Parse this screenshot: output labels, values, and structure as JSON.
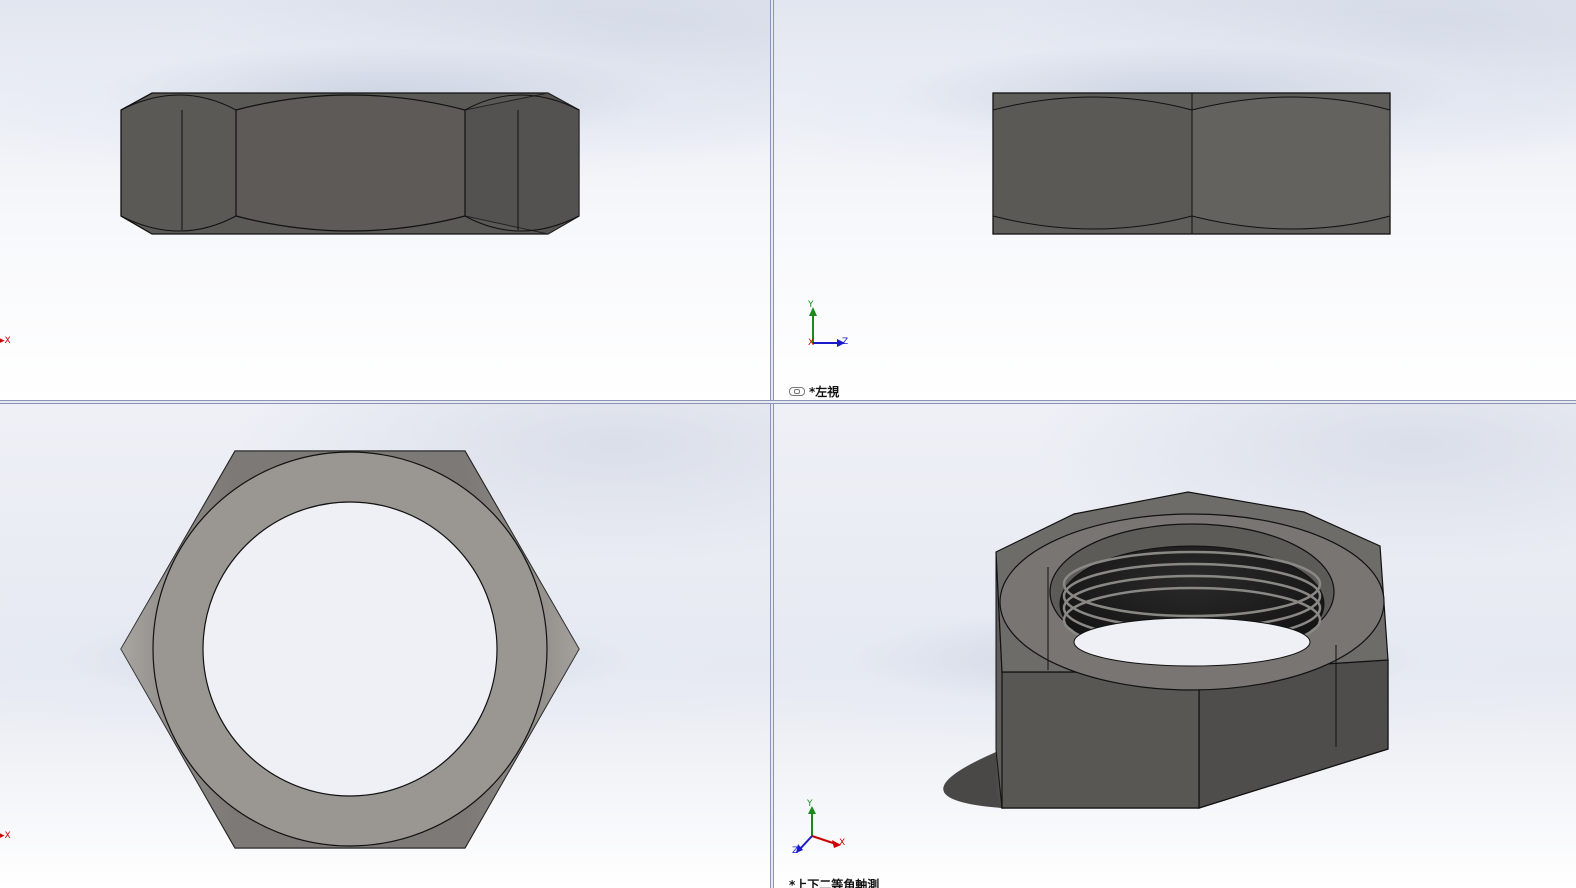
{
  "viewports": {
    "top_left": {
      "label": ""
    },
    "top_right": {
      "label": "*左視"
    },
    "bottom_left": {
      "label": ""
    },
    "bottom_right": {
      "label": "*上下二等角軸測"
    }
  },
  "triad": {
    "x_label": "X",
    "y_label": "Y",
    "z_label": "Z"
  },
  "colors": {
    "x_axis": "#cc0000",
    "y_axis": "#1a8a1a",
    "z_axis": "#1a1acc",
    "model_dark": "#5a5855",
    "model_light": "#9a9794"
  },
  "icons": {
    "view_link": "link-icon"
  }
}
